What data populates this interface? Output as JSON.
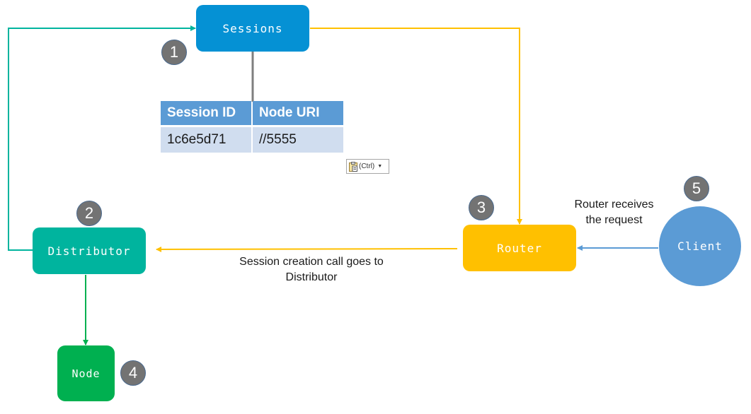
{
  "diagram": {
    "nodes": {
      "sessions": {
        "label": "Sessions",
        "color": "#0591d4",
        "step": "1"
      },
      "distributor": {
        "label": "Distributor",
        "color": "#00b49e",
        "step": "2"
      },
      "router": {
        "label": "Router",
        "color": "#ffc000",
        "step": "3"
      },
      "node": {
        "label": "Node",
        "color": "#00b050",
        "step": "4"
      },
      "client": {
        "label": "Client",
        "color": "#5b9bd5",
        "step": "5"
      }
    },
    "edges": [
      {
        "from": "client",
        "to": "router",
        "color": "#5b9bd5"
      },
      {
        "from": "router",
        "to": "distributor",
        "color": "#ffc000"
      },
      {
        "from": "sessions",
        "to": "router",
        "color": "#ffc000"
      },
      {
        "from": "distributor",
        "to": "sessions",
        "color": "#00b49e"
      },
      {
        "from": "distributor",
        "to": "node",
        "color": "#00b050"
      },
      {
        "from": "sessions",
        "to": "session-table",
        "color": "#808080"
      }
    ],
    "annotations": {
      "router_receives": "Router receives the request",
      "session_call": "Session creation call goes to Distributor"
    },
    "session_table": {
      "headers": [
        "Session ID",
        "Node URI"
      ],
      "rows": [
        [
          "1c6e5d71",
          "//5555"
        ]
      ]
    },
    "paste_options": {
      "label": "(Ctrl)",
      "icon": "clipboard-icon"
    }
  }
}
